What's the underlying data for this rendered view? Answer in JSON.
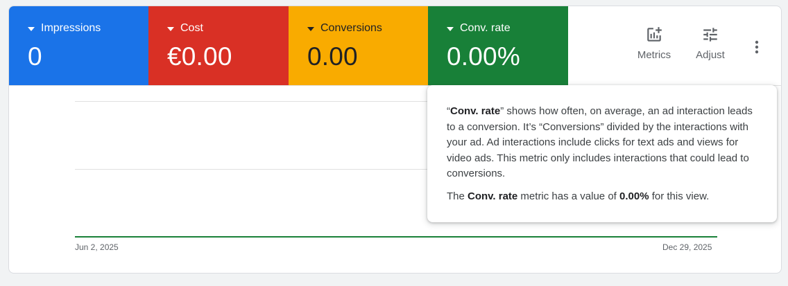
{
  "metrics": [
    {
      "label": "Impressions",
      "value": "0",
      "color": "#1a73e8"
    },
    {
      "label": "Cost",
      "value": "€0.00",
      "color": "#d93025"
    },
    {
      "label": "Conversions",
      "value": "0.00",
      "color": "#f9ab00"
    },
    {
      "label": "Conv. rate",
      "value": "0.00%",
      "color": "#188038"
    }
  ],
  "toolbar": {
    "metrics_label": "Metrics",
    "metrics_icon": "add-chart-icon",
    "adjust_label": "Adjust",
    "adjust_icon": "tune-icon",
    "more_icon": "more-vert-icon"
  },
  "chart_data": {
    "type": "line",
    "x": [
      "Jun 2, 2025",
      "Dec 29, 2025"
    ],
    "series": [
      {
        "values": [
          0,
          0
        ],
        "color": "#188038"
      }
    ],
    "xlabel": "",
    "ylabel": "",
    "grid": true
  },
  "tooltip": {
    "p1_open_quote": "“",
    "p1_metric": "Conv. rate",
    "p1_close_quote": "”",
    "p1_body": " shows how often, on average, an ad interaction leads to a conversion. It’s “Conversions” divided by the interactions with your ad. Ad interactions include clicks for text ads and views for video ads. This metric only includes interactions that could lead to conversions.",
    "p2_prefix": "The ",
    "p2_metric": "Conv. rate",
    "p2_mid": " metric has a value of ",
    "p2_value": "0.00%",
    "p2_suffix": " for this view."
  }
}
